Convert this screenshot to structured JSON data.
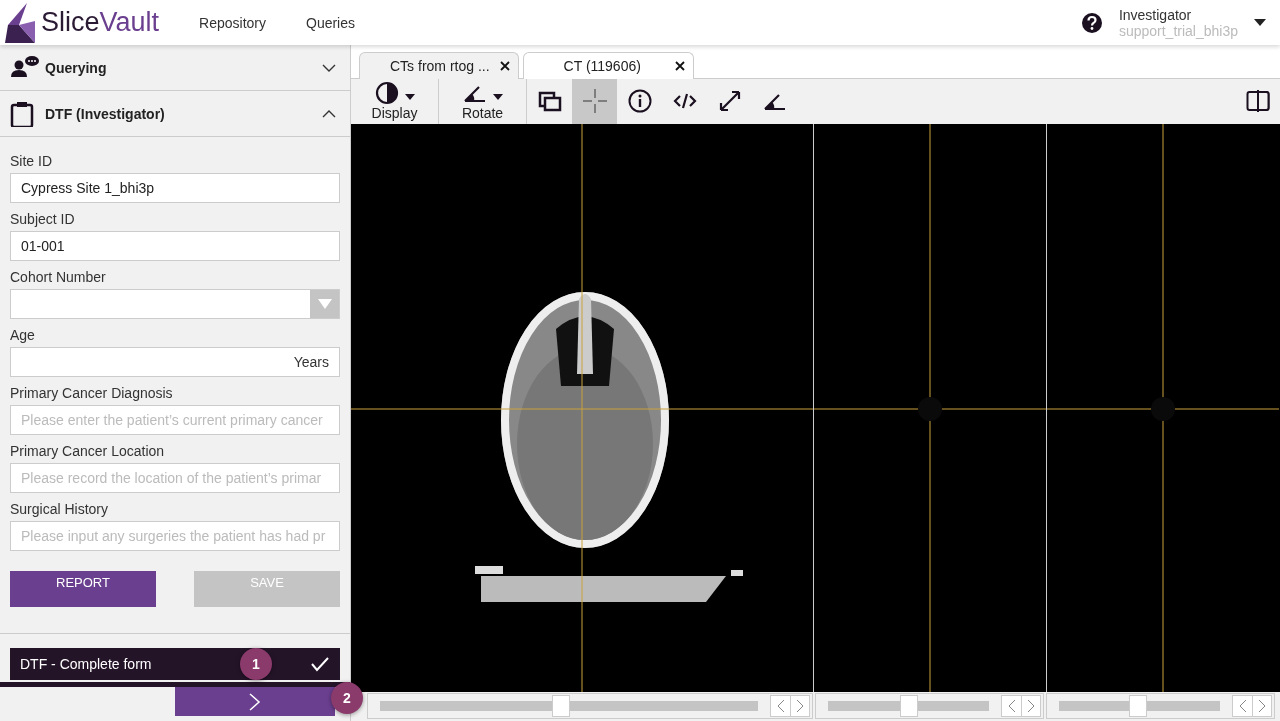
{
  "header": {
    "brand": {
      "part_1": "Slice",
      "part_2": "Vault"
    },
    "nav": [
      {
        "label": "Repository",
        "selected": false
      },
      {
        "label": "Queries",
        "selected": false
      }
    ],
    "user": {
      "name": "Investigator",
      "account": "support_trial_bhi3p"
    }
  },
  "sidebar": {
    "sections": [
      {
        "kind": "querying",
        "title": "Querying",
        "expanded": false
      },
      {
        "kind": "form",
        "title": "DTF (Investigator)",
        "expanded": true
      }
    ],
    "fields": [
      {
        "kind": "text",
        "label": "Site ID",
        "value": "Cypress Site 1_bhi3p"
      },
      {
        "kind": "text",
        "label": "Subject ID",
        "value": "01-001"
      },
      {
        "kind": "select",
        "label": "Cohort Number"
      },
      {
        "kind": "unit",
        "label": "Age",
        "suffix": "Years"
      },
      {
        "kind": "text",
        "label": "Primary Cancer Diagnosis",
        "placeholder": "Please enter the patient’s current primary cancer"
      },
      {
        "kind": "text",
        "label": "Primary Cancer Location",
        "placeholder": "Please record the location of the patient’s primar"
      },
      {
        "kind": "text",
        "label": "Surgical History",
        "placeholder": "Please input any surgeries the patient has had pr"
      }
    ],
    "buttons": [
      {
        "label": "REPORT",
        "disabled": false
      },
      {
        "label": "SAVE",
        "disabled": true
      }
    ],
    "task": {
      "label": "DTF - Complete form",
      "done": true,
      "badge": "1"
    },
    "next_badge": "2"
  },
  "viewer": {
    "tabs": [
      {
        "label": "CTs from rtog ...",
        "selected": false
      },
      {
        "label": "CT (119606)",
        "selected": true
      }
    ],
    "toolbar": [
      {
        "kind": "display",
        "label": "Display",
        "has_menu": true,
        "active": false
      },
      {
        "kind": "rotate",
        "label": "Rotate",
        "has_menu": true,
        "active": false
      },
      {
        "kind": "layers",
        "active": false
      },
      {
        "kind": "crosshair",
        "active": true
      },
      {
        "kind": "info",
        "active": false
      },
      {
        "kind": "code",
        "active": false
      },
      {
        "kind": "expand",
        "active": false
      },
      {
        "kind": "angle",
        "active": false
      }
    ],
    "panes": [
      {
        "kind": "axial",
        "level": 0.48
      },
      {
        "kind": "empty",
        "level": 0.5
      },
      {
        "kind": "empty",
        "level": 0.49
      }
    ]
  }
}
